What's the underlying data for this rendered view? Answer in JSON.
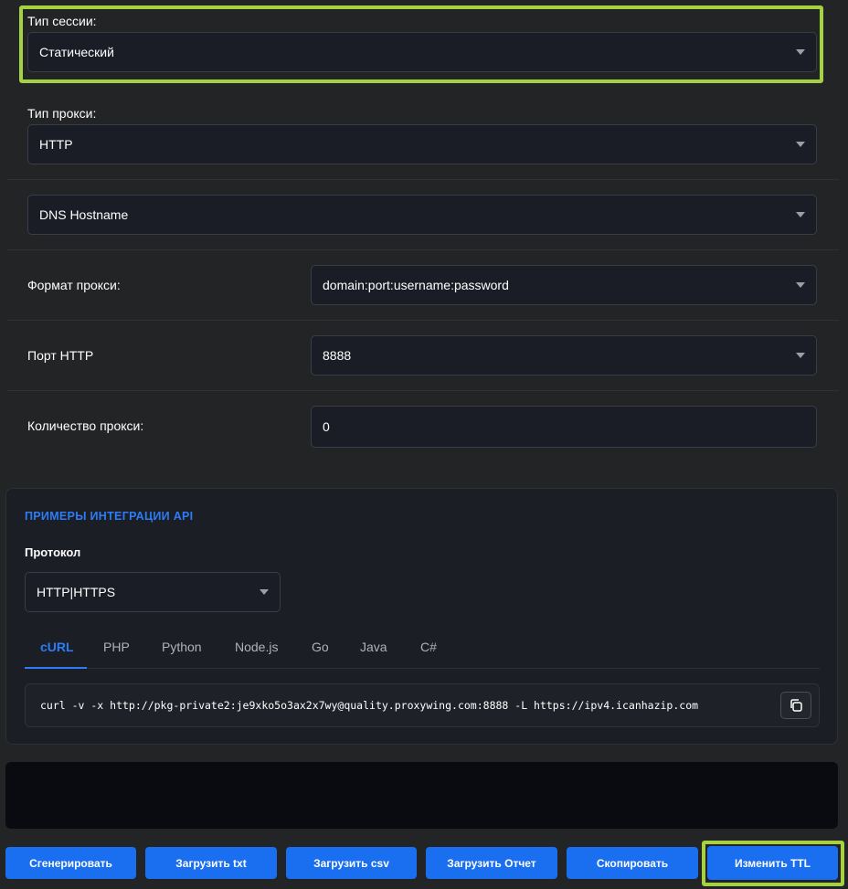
{
  "session": {
    "label": "Тип сессии:",
    "value": "Статический"
  },
  "proxy_type": {
    "label": "Тип прокси:",
    "value": "HTTP"
  },
  "dns": {
    "value": "DNS Hostname"
  },
  "format": {
    "label": "Формат прокси:",
    "value": "domain:port:username:password"
  },
  "port": {
    "label": "Порт HTTP",
    "value": "8888"
  },
  "count": {
    "label": "Количество прокси:",
    "value": "0"
  },
  "api": {
    "title": "ПРИМЕРЫ ИНТЕГРАЦИИ API",
    "protocol_label": "Протокол",
    "protocol_value": "HTTP|HTTPS",
    "tabs": [
      "cURL",
      "PHP",
      "Python",
      "Node.js",
      "Go",
      "Java",
      "C#"
    ],
    "active_tab": "cURL",
    "code": "curl -v -x http://pkg-private2:je9xko5o3ax2x7wy@quality.proxywing.com:8888 -L https://ipv4.icanhazip.com"
  },
  "buttons": {
    "generate": "Сгенерировать",
    "upload_txt": "Загрузить txt",
    "upload_csv": "Загрузить csv",
    "upload_report": "Загрузить Отчет",
    "copy": "Скопировать",
    "change_ttl": "Изменить TTL"
  },
  "colors": {
    "accent": "#2b7cf6",
    "button": "#1a6ff0",
    "highlight": "#a6d140",
    "background": "#232426"
  }
}
